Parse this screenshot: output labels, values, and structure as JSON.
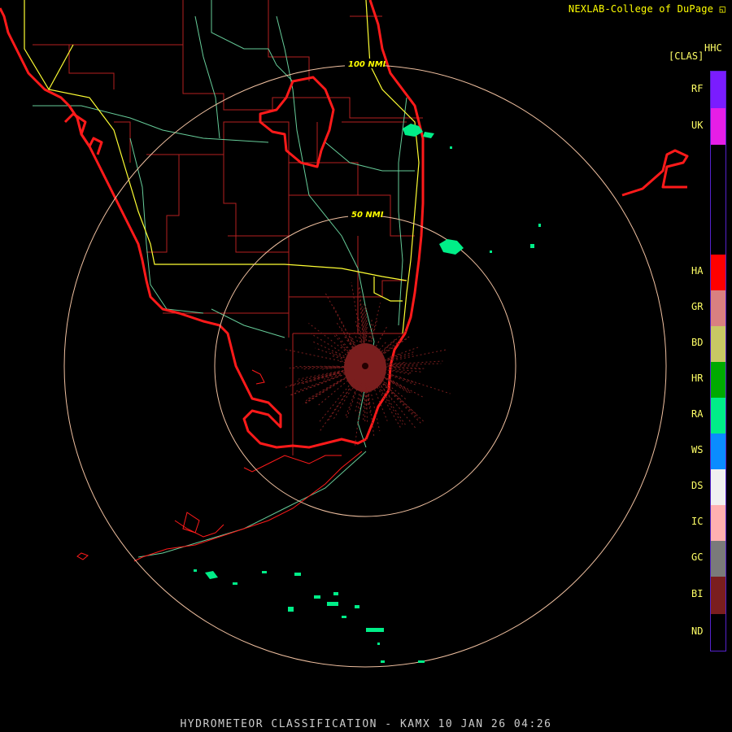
{
  "header": {
    "credit": "NEXLAB-College of DuPage"
  },
  "legend": {
    "product": "HHC",
    "bracket": "[CLAS]",
    "items": [
      {
        "code": "RF",
        "color": "#7a1cff"
      },
      {
        "code": "UK",
        "color": "#e61ee6"
      },
      {
        "code": "",
        "color": "#000000"
      },
      {
        "code": "HA",
        "color": "#ff0000"
      },
      {
        "code": "GR",
        "color": "#d98080"
      },
      {
        "code": "BD",
        "color": "#c8c864"
      },
      {
        "code": "HR",
        "color": "#00aa00"
      },
      {
        "code": "RA",
        "color": "#00ee88"
      },
      {
        "code": "WS",
        "color": "#0a8cff"
      },
      {
        "code": "DS",
        "color": "#f0f0f0"
      },
      {
        "code": "IC",
        "color": "#ffb0b0"
      },
      {
        "code": "GC",
        "color": "#7a7a7a"
      },
      {
        "code": "BI",
        "color": "#7a1e1e"
      },
      {
        "code": "ND",
        "color": "#000000"
      }
    ]
  },
  "rings": [
    {
      "label": "100 NMI"
    },
    {
      "label": "50 NMI"
    }
  ],
  "footer": {
    "title": "HYDROMETEOR CLASSIFICATION - KAMX 10 JAN 26 04:26"
  },
  "colors": {
    "coastline": "#ff1a1a",
    "county": "#b32020",
    "highway": "#ffff33",
    "road": "#66cc99",
    "ring": "#f0c0a0",
    "rain": "#00ee88",
    "clutter": "#7a1e1e"
  }
}
